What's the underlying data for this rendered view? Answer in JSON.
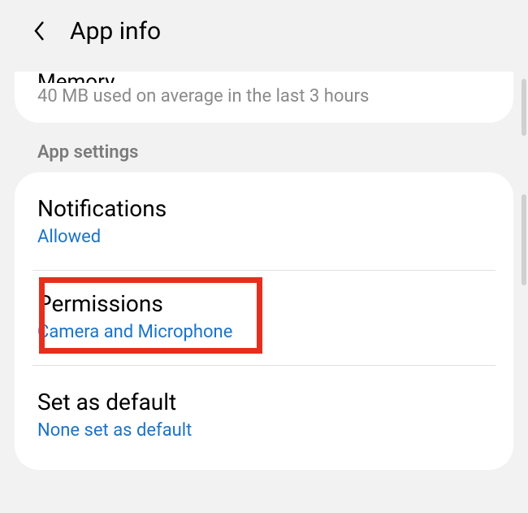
{
  "header": {
    "title": "App info"
  },
  "memory": {
    "title_cut": "Memory",
    "subtitle": "40 MB used on average in the last 3 hours"
  },
  "section_label": "App settings",
  "items": {
    "notifications": {
      "title": "Notifications",
      "status": "Allowed"
    },
    "permissions": {
      "title": "Permissions",
      "status": "Camera and Microphone"
    },
    "set_as_default": {
      "title": "Set as default",
      "status": "None set as default"
    }
  }
}
